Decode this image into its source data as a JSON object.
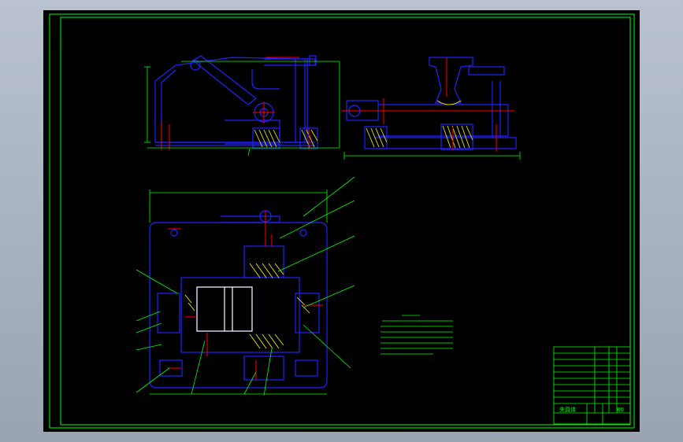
{
  "drawing": {
    "background": "#000000",
    "frame_color": "#00ff00",
    "part_color": "#2222ff",
    "dim_color": "#00ff00",
    "center_color": "#ff0000",
    "hatch_color": "#ffff00",
    "title_block": {
      "labels": [
        "夹具体",
        "80"
      ]
    },
    "part_numbers": [
      "1",
      "2",
      "3",
      "4",
      "5",
      "6",
      "7",
      "8",
      "9",
      "10",
      "11",
      "12",
      "13"
    ]
  }
}
